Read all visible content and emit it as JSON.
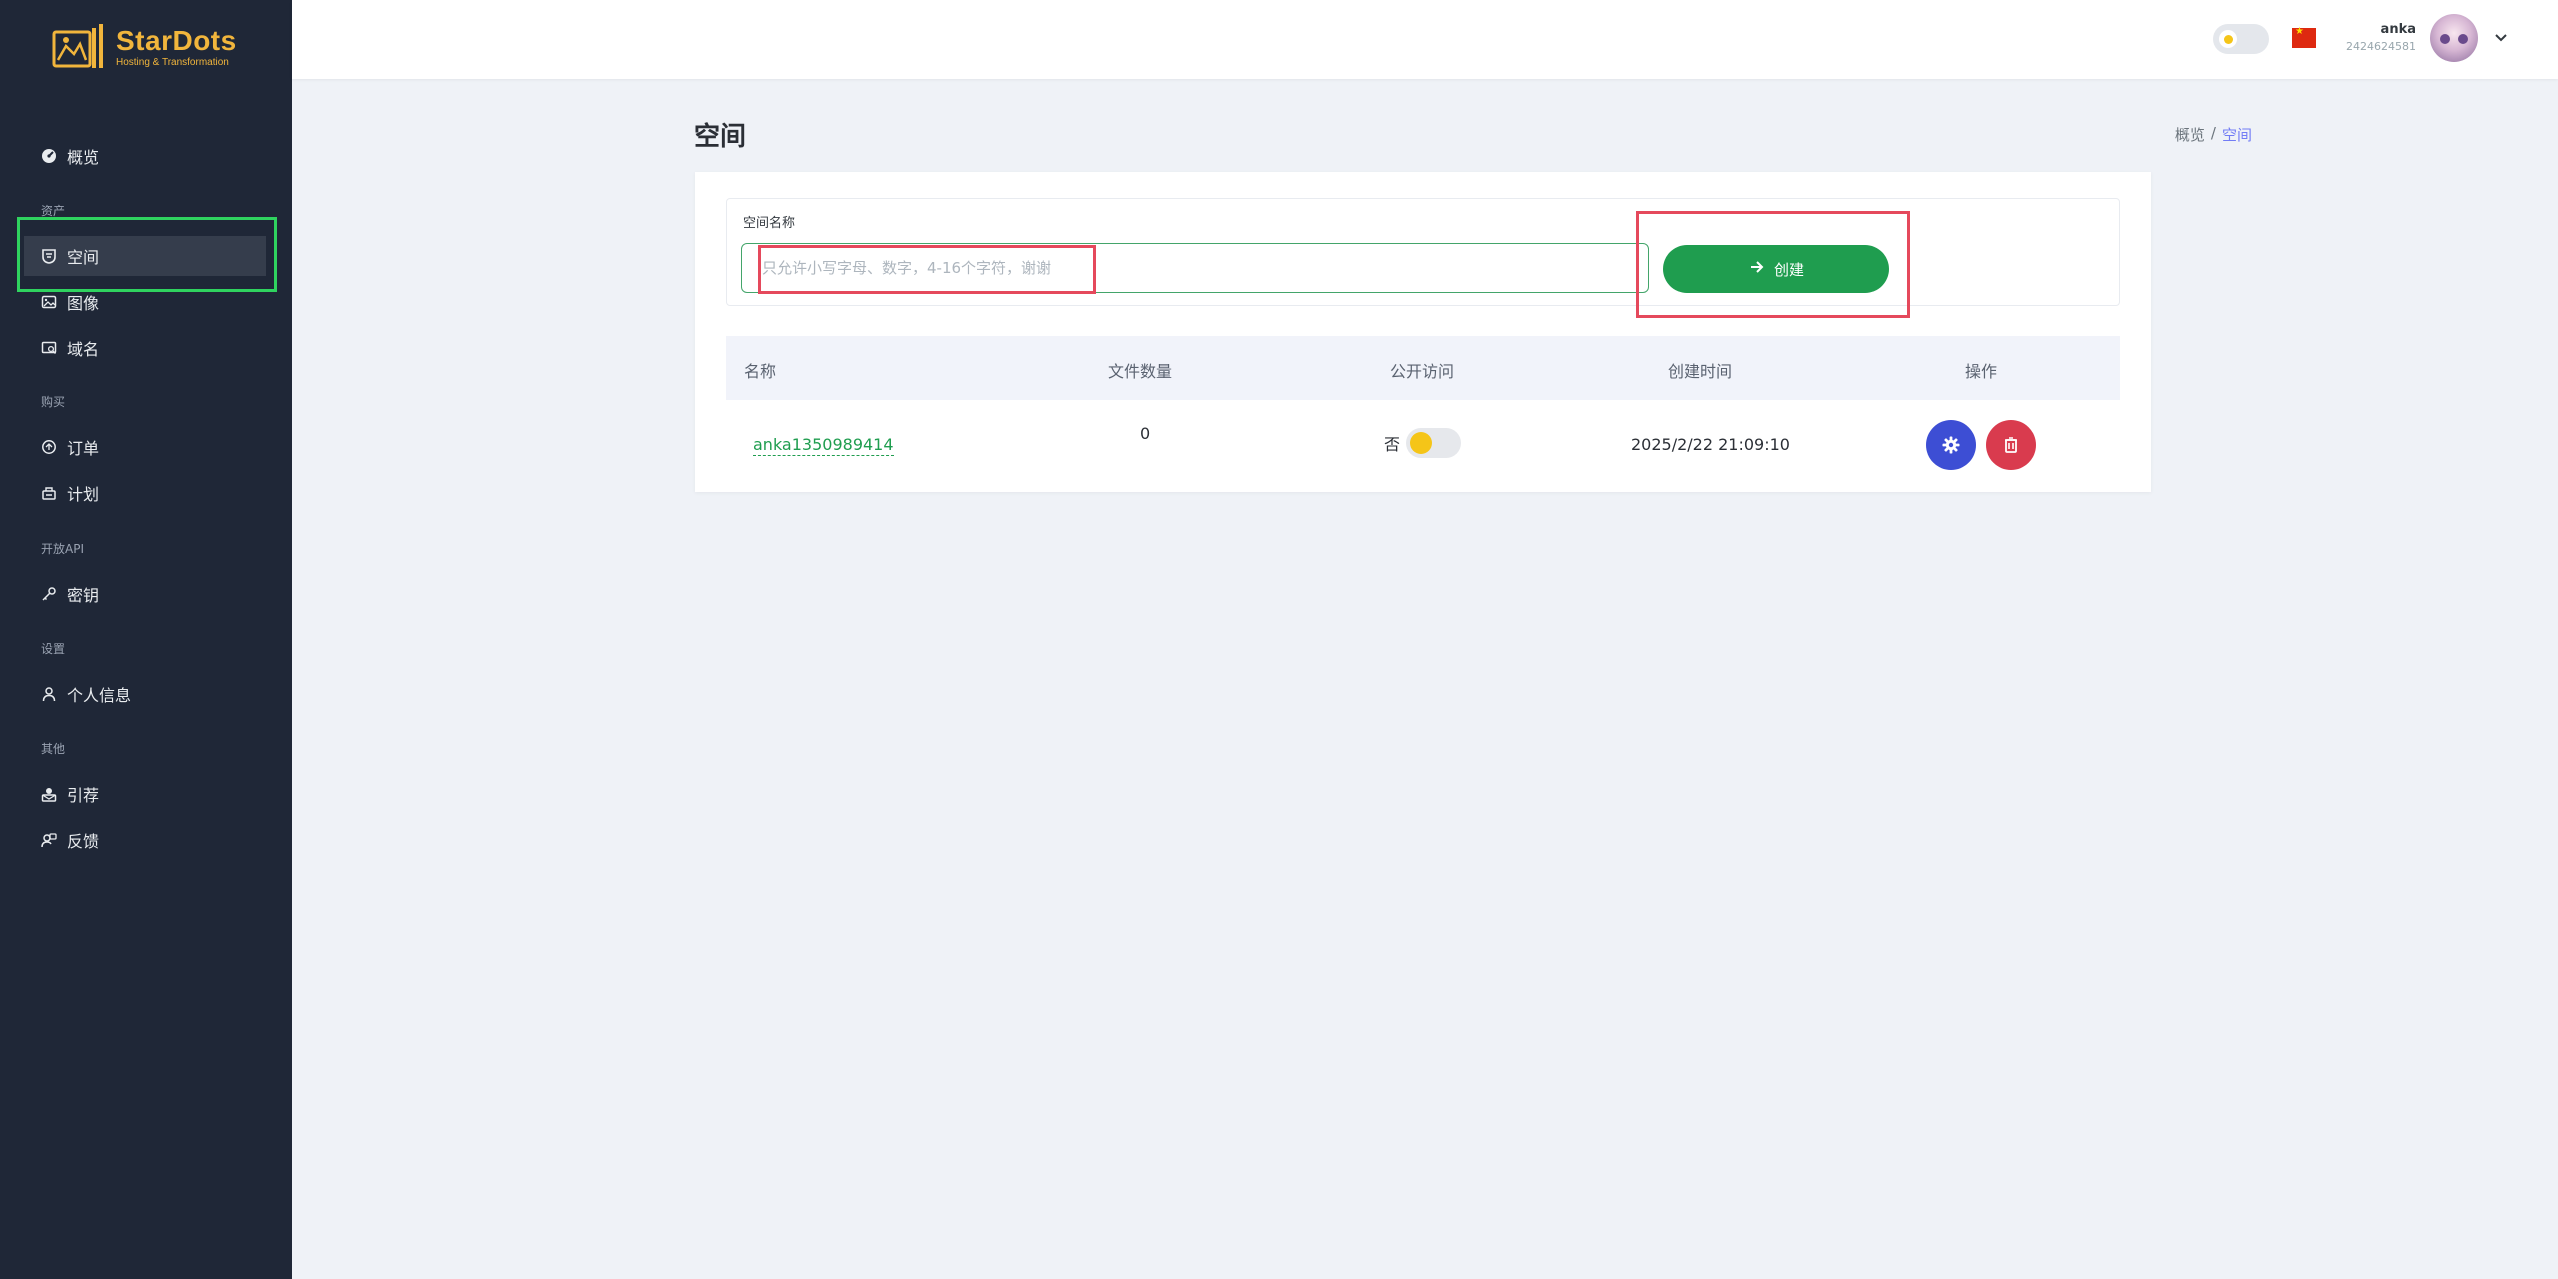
{
  "brand": {
    "name": "StarDots",
    "tagline": "Hosting & Transformation",
    "color": "#f1b53c"
  },
  "sidebar": {
    "items": [
      {
        "label": "概览",
        "icon": "dashboard-icon"
      },
      {
        "section": "资产"
      },
      {
        "label": "空间",
        "icon": "shield-icon",
        "active": true
      },
      {
        "label": "图像",
        "icon": "image-icon"
      },
      {
        "label": "域名",
        "icon": "domain-icon"
      },
      {
        "section": "购买"
      },
      {
        "label": "订单",
        "icon": "order-icon"
      },
      {
        "label": "计划",
        "icon": "plan-icon"
      },
      {
        "section": "开放API"
      },
      {
        "label": "密钥",
        "icon": "key-icon"
      },
      {
        "section": "设置"
      },
      {
        "label": "个人信息",
        "icon": "user-icon"
      },
      {
        "section": "其他"
      },
      {
        "label": "引荐",
        "icon": "referral-icon"
      },
      {
        "label": "反馈",
        "icon": "feedback-icon"
      }
    ]
  },
  "header": {
    "user_name": "anka",
    "user_id": "2424624581",
    "flag": "china-flag-icon"
  },
  "page": {
    "title": "空间",
    "breadcrumb": {
      "parent": "概览",
      "separator": "/",
      "current": "空间"
    }
  },
  "form": {
    "label": "空间名称",
    "value": "",
    "placeholder": "只允许小写字母、数字，4-16个字符，谢谢",
    "create_label": "创建"
  },
  "table": {
    "columns": [
      "名称",
      "文件数量",
      "公开访问",
      "创建时间",
      "操作"
    ],
    "rows": [
      {
        "name": "anka1350989414",
        "file_count": "0",
        "public_label": "否",
        "public": false,
        "created_at": "2025/2/22 21:09:10"
      }
    ]
  },
  "colors": {
    "sidebar_bg": "#1f2737",
    "primary_green": "#1f9d4f",
    "settings_blue": "#3d4ed4",
    "delete_red": "#d93b4e",
    "highlight_red": "#e5495c",
    "highlight_green": "#2fd35f"
  }
}
